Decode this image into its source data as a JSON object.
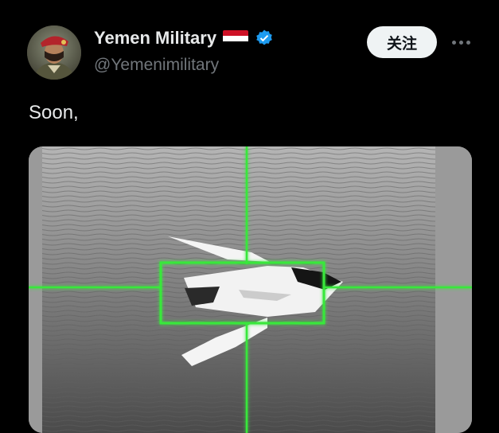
{
  "tweet": {
    "author": {
      "display_name": "Yemen Military",
      "handle": "@Yemenimilitary",
      "verified_icon": "verified-badge-icon",
      "flag_icon": "yemen-flag-icon",
      "flag_colors": [
        "#ce1126",
        "#ffffff",
        "#000000"
      ]
    },
    "follow_label": "关注",
    "more_icon": "more-options-icon",
    "text": "Soon,",
    "media": {
      "description_icon": "thermal-targeting-video",
      "reticle_color": "#39e83a"
    }
  }
}
